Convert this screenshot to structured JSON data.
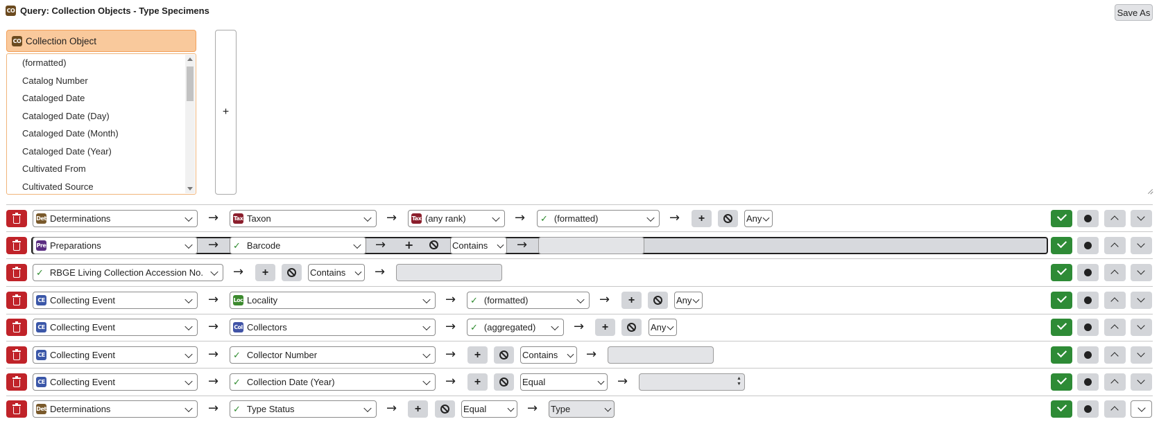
{
  "header": {
    "title_icon": "CO",
    "title": "Query: Collection Objects - Type Specimens",
    "save_as": "Save As"
  },
  "picker": {
    "table_icon": "CO",
    "table": "Collection Object",
    "add_label": "+",
    "fields": [
      "(formatted)",
      "Catalog Number",
      "Cataloged Date",
      "Cataloged Date (Day)",
      "Cataloged Date (Month)",
      "Cataloged Date (Year)",
      "Cultivated From",
      "Cultivated Source"
    ]
  },
  "common": {
    "plus": "+",
    "arrow": "→",
    "check": "✓"
  },
  "rows": [
    {
      "path": [
        {
          "icon": "Det",
          "label": "Determinations"
        },
        {
          "icon": "Tax",
          "label": "Taxon"
        },
        {
          "icon": "Tax",
          "label": "(any rank)"
        },
        {
          "label": "(formatted)"
        }
      ],
      "operator": "Any"
    },
    {
      "path": [
        {
          "icon": "Pre",
          "label": "Preparations"
        },
        {
          "label": "Barcode"
        }
      ],
      "operator": "Contains"
    },
    {
      "path": [
        {
          "label": "RBGE Living Collection Accession No."
        }
      ],
      "operator": "Contains"
    },
    {
      "path": [
        {
          "icon": "CE",
          "label": "Collecting Event"
        },
        {
          "icon": "Loc",
          "label": "Locality"
        },
        {
          "label": "(formatted)"
        }
      ],
      "operator": "Any"
    },
    {
      "path": [
        {
          "icon": "CE",
          "label": "Collecting Event"
        },
        {
          "icon": "Col",
          "label": "Collectors"
        },
        {
          "label": "(aggregated)"
        }
      ],
      "operator": "Any"
    },
    {
      "path": [
        {
          "icon": "CE",
          "label": "Collecting Event"
        },
        {
          "label": "Collector Number"
        }
      ],
      "operator": "Contains"
    },
    {
      "path": [
        {
          "icon": "CE",
          "label": "Collecting Event"
        },
        {
          "label": "Collection Date (Year)"
        }
      ],
      "operator": "Equal"
    },
    {
      "path": [
        {
          "icon": "Det",
          "label": "Determinations"
        },
        {
          "label": "Type Status"
        }
      ],
      "operator": "Equal",
      "value": "Type"
    }
  ]
}
